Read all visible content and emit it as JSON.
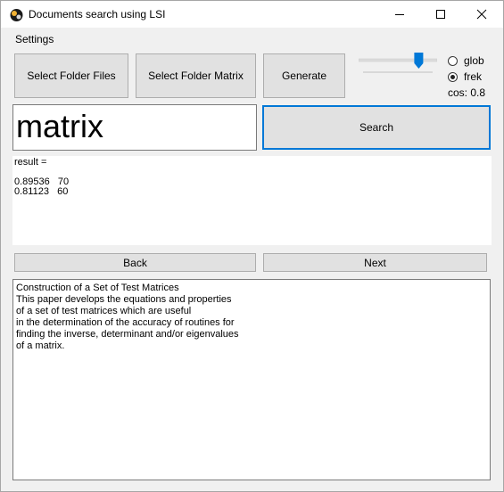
{
  "window": {
    "title": "Documents search using LSI"
  },
  "menu": {
    "settings": "Settings"
  },
  "toolbar": {
    "select_folder_files": "Select Folder Files",
    "select_folder_matrix": "Select Folder Matrix",
    "generate": "Generate"
  },
  "options": {
    "slider_value_fraction": 0.8,
    "radio_glob": "glob",
    "radio_frek": "frek",
    "selected_radio": "frek",
    "cos_text": "cos: 0.8"
  },
  "search": {
    "query_value": "matrix",
    "button_label": "Search"
  },
  "result": {
    "header": "result =",
    "rows": [
      "0.89536   70",
      "0.81123   60"
    ]
  },
  "nav": {
    "back": "Back",
    "next": "Next"
  },
  "document": {
    "lines": [
      "Construction of a Set of Test Matrices",
      "This paper develops the equations and properties",
      "of a set of test matrices which are useful",
      "in the determination of the accuracy of routines for",
      "finding the inverse, determinant and/or eigenvalues",
      "of a matrix."
    ]
  },
  "colors": {
    "accent": "#0078d7",
    "button_face": "#e1e1e1",
    "window_bg": "#f0f0f0"
  }
}
